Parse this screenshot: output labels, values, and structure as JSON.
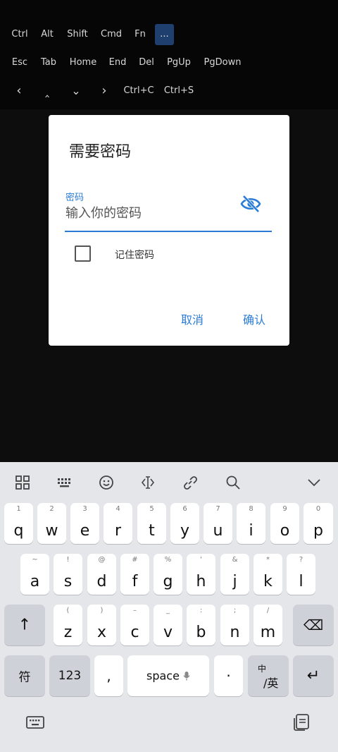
{
  "extra_keys": {
    "row1": [
      "Ctrl",
      "Alt",
      "Shift",
      "Cmd",
      "Fn",
      "..."
    ],
    "row2": [
      "Esc",
      "Tab",
      "Home",
      "End",
      "Del",
      "PgUp",
      "PgDown"
    ],
    "row3": [
      "‹",
      "‸",
      "⌄",
      "›",
      "Ctrl+C",
      "Ctrl+S"
    ]
  },
  "dialog": {
    "title": "需要密码",
    "field_label": "密码",
    "field_placeholder": "输入你的密码",
    "field_value": "",
    "remember_label": "记住密码",
    "remember_checked": false,
    "cancel_label": "取消",
    "confirm_label": "确认"
  },
  "keyboard": {
    "toolbar_icons": [
      "grid-icon",
      "keyboard-layout-icon",
      "emoji-icon",
      "cursor-icon",
      "link-icon",
      "search-icon",
      "chevron-down-icon"
    ],
    "row1": [
      {
        "hint": "1",
        "key": "q"
      },
      {
        "hint": "2",
        "key": "w"
      },
      {
        "hint": "3",
        "key": "e"
      },
      {
        "hint": "4",
        "key": "r"
      },
      {
        "hint": "5",
        "key": "t"
      },
      {
        "hint": "6",
        "key": "y"
      },
      {
        "hint": "7",
        "key": "u"
      },
      {
        "hint": "8",
        "key": "i"
      },
      {
        "hint": "9",
        "key": "o"
      },
      {
        "hint": "0",
        "key": "p"
      }
    ],
    "row2": [
      {
        "hint": "~",
        "key": "a"
      },
      {
        "hint": "!",
        "key": "s"
      },
      {
        "hint": "@",
        "key": "d"
      },
      {
        "hint": "#",
        "key": "f"
      },
      {
        "hint": "%",
        "key": "g"
      },
      {
        "hint": "'",
        "key": "h"
      },
      {
        "hint": "&",
        "key": "j"
      },
      {
        "hint": "*",
        "key": "k"
      },
      {
        "hint": "?",
        "key": "l"
      }
    ],
    "row3": [
      {
        "hint": "(",
        "key": "z"
      },
      {
        "hint": ")",
        "key": "x"
      },
      {
        "hint": "–",
        "key": "c"
      },
      {
        "hint": "_",
        "key": "v"
      },
      {
        "hint": ":",
        "key": "b"
      },
      {
        "hint": ";",
        "key": "n"
      },
      {
        "hint": "/",
        "key": "m"
      }
    ],
    "shift_glyph": "↑",
    "backspace_glyph": "⌫",
    "symbol_label": "符",
    "num_label": "123",
    "comma_label": ",",
    "space_label": "space",
    "period_label": "·",
    "lang_top": "中",
    "lang_bottom": "/英",
    "enter_glyph": "↵"
  },
  "colors": {
    "accent": "#2a7bd6",
    "keyboard_bg": "#e5e6ea",
    "terminal_bg": "#0b0b0b"
  }
}
